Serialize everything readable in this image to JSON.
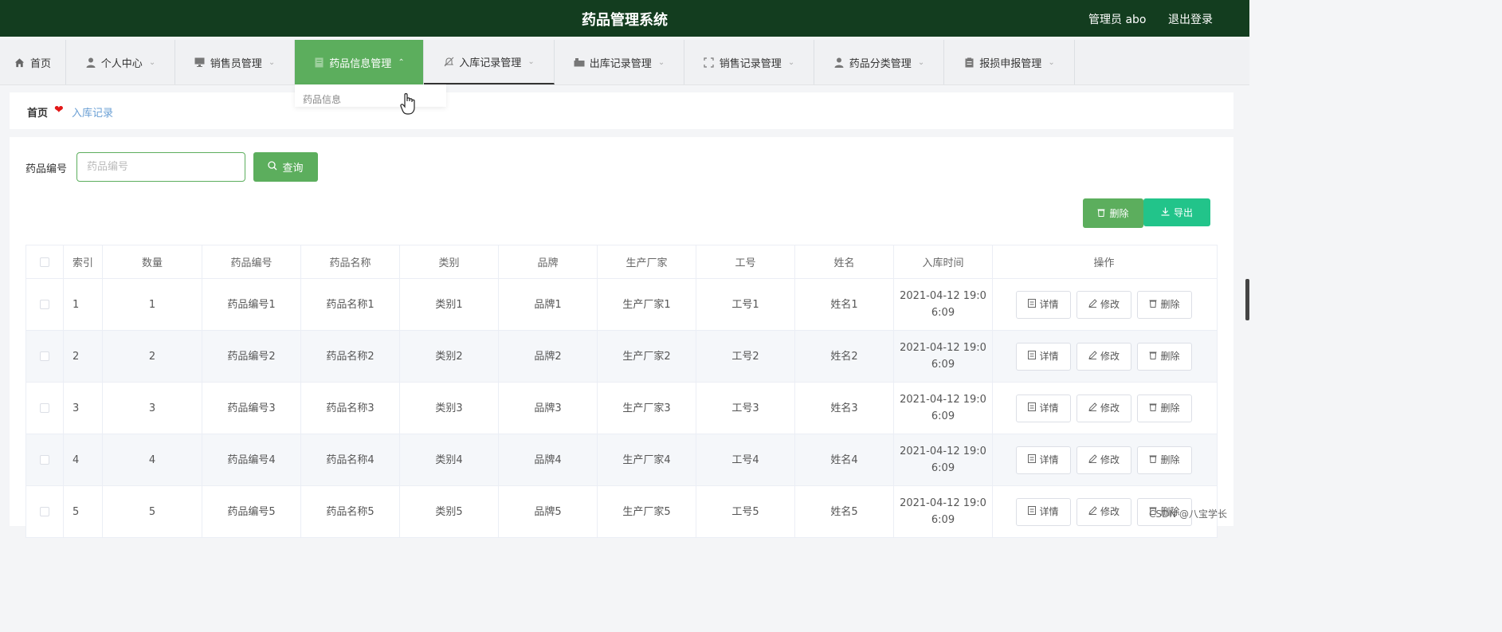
{
  "header": {
    "title": "药品管理系统",
    "user": "管理员 abo",
    "logout": "退出登录"
  },
  "nav": {
    "items": [
      {
        "label": "首页",
        "icon": "home-icon"
      },
      {
        "label": "个人中心",
        "icon": "user-icon"
      },
      {
        "label": "销售员管理",
        "icon": "monitor-icon"
      },
      {
        "label": "药品信息管理",
        "icon": "document-icon"
      },
      {
        "label": "入库记录管理",
        "icon": "bell-off-icon"
      },
      {
        "label": "出库记录管理",
        "icon": "box-icon"
      },
      {
        "label": "销售记录管理",
        "icon": "fullscreen-icon"
      },
      {
        "label": "药品分类管理",
        "icon": "user-icon"
      },
      {
        "label": "报损申报管理",
        "icon": "clipboard-icon"
      }
    ],
    "dropdown_option": "药品信息"
  },
  "breadcrumb": {
    "home": "首页",
    "current": "入库记录"
  },
  "search": {
    "label": "药品编号",
    "placeholder": "药品编号",
    "button": "查询"
  },
  "actions": {
    "delete": "删除",
    "export": "导出"
  },
  "table": {
    "headers": [
      "索引",
      "数量",
      "药品编号",
      "药品名称",
      "类别",
      "品牌",
      "生产厂家",
      "工号",
      "姓名",
      "入库时间",
      "操作"
    ],
    "rows": [
      {
        "index": "1",
        "qty": "1",
        "code": "药品编号1",
        "name": "药品名称1",
        "category": "类别1",
        "brand": "品牌1",
        "maker": "生产厂家1",
        "job_no": "工号1",
        "person": "姓名1",
        "time_a": "2021-04-12 19:0",
        "time_b": "6:09"
      },
      {
        "index": "2",
        "qty": "2",
        "code": "药品编号2",
        "name": "药品名称2",
        "category": "类别2",
        "brand": "品牌2",
        "maker": "生产厂家2",
        "job_no": "工号2",
        "person": "姓名2",
        "time_a": "2021-04-12 19:0",
        "time_b": "6:09"
      },
      {
        "index": "3",
        "qty": "3",
        "code": "药品编号3",
        "name": "药品名称3",
        "category": "类别3",
        "brand": "品牌3",
        "maker": "生产厂家3",
        "job_no": "工号3",
        "person": "姓名3",
        "time_a": "2021-04-12 19:0",
        "time_b": "6:09"
      },
      {
        "index": "4",
        "qty": "4",
        "code": "药品编号4",
        "name": "药品名称4",
        "category": "类别4",
        "brand": "品牌4",
        "maker": "生产厂家4",
        "job_no": "工号4",
        "person": "姓名4",
        "time_a": "2021-04-12 19:0",
        "time_b": "6:09"
      },
      {
        "index": "5",
        "qty": "5",
        "code": "药品编号5",
        "name": "药品名称5",
        "category": "类别5",
        "brand": "品牌5",
        "maker": "生产厂家5",
        "job_no": "工号5",
        "person": "姓名5",
        "time_a": "2021-04-12 19:0",
        "time_b": "6:09"
      }
    ],
    "row_actions": {
      "detail": "详情",
      "edit": "修改",
      "delete": "删除"
    }
  },
  "watermark": "CSDN @八宝学长",
  "colors": {
    "header_bg": "#133d1f",
    "primary": "#5cae5d",
    "export": "#22c48a",
    "heart": "#e21818"
  }
}
